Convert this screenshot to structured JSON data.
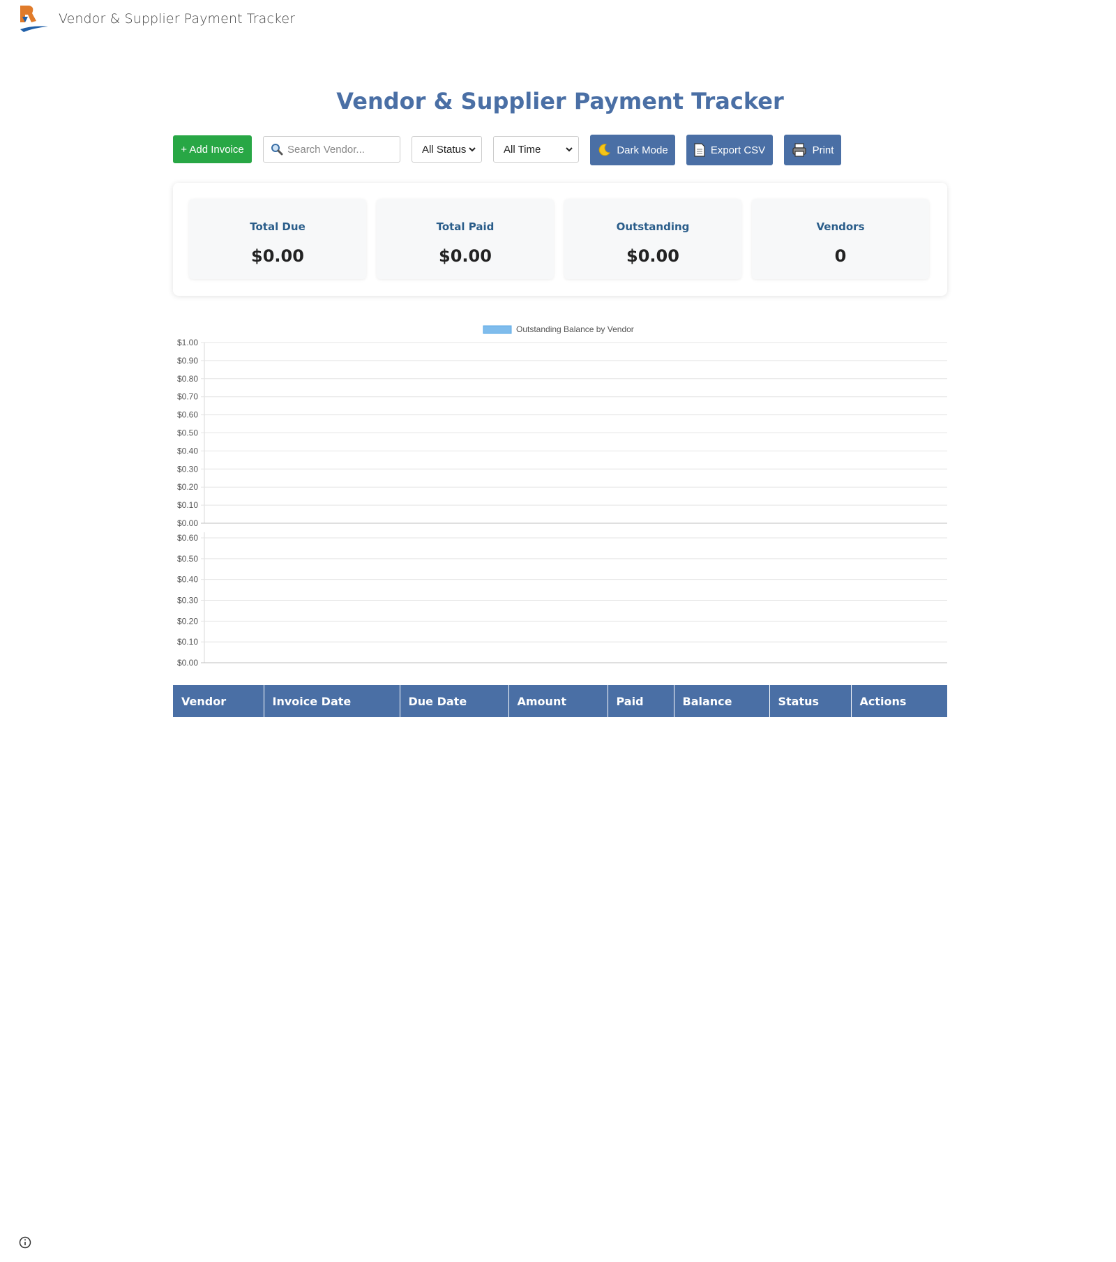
{
  "header": {
    "app_title": "Vendor & Supplier Payment Tracker",
    "logo_icon": "brand-logo-icon"
  },
  "page": {
    "title": "Vendor & Supplier Payment Tracker"
  },
  "toolbar": {
    "add_label": "+ Add Invoice",
    "search_placeholder": "Search Vendor...",
    "search_icon": "magnifier-icon",
    "status_filter": "All Status",
    "time_filter": "All Time",
    "dark_mode_label": "Dark Mode",
    "dark_mode_icon": "moon-icon",
    "export_label": "Export CSV",
    "export_icon": "document-icon",
    "print_label": "Print",
    "print_icon": "printer-icon"
  },
  "summary": {
    "cards": [
      {
        "label": "Total Due",
        "value": "$0.00"
      },
      {
        "label": "Total Paid",
        "value": "$0.00"
      },
      {
        "label": "Outstanding",
        "value": "$0.00"
      },
      {
        "label": "Vendors",
        "value": "0"
      }
    ]
  },
  "chart_data": [
    {
      "type": "bar",
      "categories": [],
      "series": [
        {
          "name": "Outstanding Balance by Vendor",
          "values": []
        }
      ],
      "legend_color": "#7fbcec",
      "ylim": [
        0,
        1
      ],
      "yticks": [
        "$1.00",
        "$0.90",
        "$0.80",
        "$0.70",
        "$0.60",
        "$0.50",
        "$0.40",
        "$0.30",
        "$0.20",
        "$0.10",
        "$0.00"
      ],
      "legend": "top-center",
      "grid": true
    },
    {
      "type": "bar",
      "categories": [],
      "series": [],
      "ylim": [
        0,
        0.6
      ],
      "yticks": [
        "$0.60",
        "$0.50",
        "$0.40",
        "$0.30",
        "$0.20",
        "$0.10",
        "$0.00"
      ],
      "grid": true
    }
  ],
  "table": {
    "columns": [
      "Vendor",
      "Invoice Date",
      "Due Date",
      "Amount",
      "Paid",
      "Balance",
      "Status",
      "Actions"
    ],
    "rows": []
  },
  "colors": {
    "primary": "#4a6fa5",
    "success": "#28a745",
    "card_label": "#2a5d8a"
  }
}
